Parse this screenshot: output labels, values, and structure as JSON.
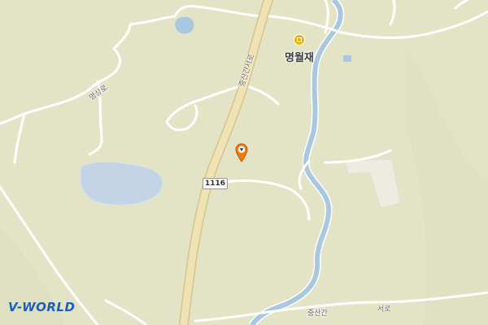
{
  "map": {
    "poi": {
      "name": "명월재",
      "icon": "lodging-icon",
      "icon_color": "#f2b000"
    },
    "roads": [
      {
        "id": "road-mid-nw",
        "label": "명상로"
      },
      {
        "id": "road-highway",
        "label": "중산간서로"
      },
      {
        "id": "road-south-east",
        "label": "중산간"
      },
      {
        "id": "road-south-east-2",
        "label": "서로"
      }
    ],
    "route_shield": "1116",
    "marker": {
      "icon": "location-pin-icon",
      "color": "#f07a10"
    },
    "logo": {
      "text_a": "V-",
      "text_b": "WORLD"
    },
    "colors": {
      "land": "#e3e3c6",
      "road": "#ffffff",
      "highway": "#e9d9a6",
      "water": "#a9c8df",
      "reservoir": "#c2d4e6"
    }
  }
}
